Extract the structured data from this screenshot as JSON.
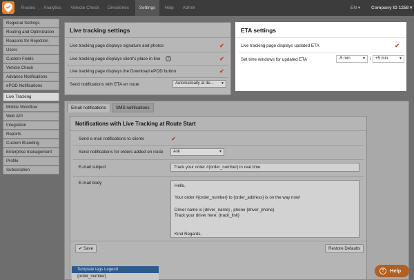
{
  "topnav": {
    "items": [
      "Routes",
      "Analytics",
      "Vehicle Check",
      "Directories",
      "Settings",
      "Help",
      "Admin"
    ],
    "active": "Settings",
    "language": "EN",
    "company": "Company ID 1258"
  },
  "sidebar": {
    "items": [
      "Regional Settings",
      "Routing and Optimization",
      "Reasons for Rejection",
      "Users",
      "Custom Fields",
      "Vehicle Check",
      "Advance Notifications",
      "ePOD Notifications",
      "Live Tracking",
      "Mobile Workflow",
      "Web API",
      "Integration",
      "Reports",
      "Custom Branding",
      "Enterprise management",
      "Profile",
      "Subscription"
    ],
    "active": "Live Tracking"
  },
  "live_tracking": {
    "title": "Live tracking settings",
    "rows": [
      "Live tracking page displays signature and photos",
      "Live tracking page displays client's place in line",
      "Live tracking page displays the Download ePOD button"
    ],
    "notify_label": "Send notifications with ETA en route",
    "notify_value": "Automatically at de..."
  },
  "eta": {
    "title": "ETA settings",
    "updated_label": "Live tracking page displays updated ETA",
    "window_label": "Set time windows for updated ETA",
    "min_value": "-5 min",
    "separator": "/",
    "max_value": "+5 min"
  },
  "tabs": [
    "Email notifications",
    "SMS notifications"
  ],
  "email": {
    "title": "Notifications with Live Tracking at Route Start",
    "send_clients_label": "Send e-mail notifications to clients",
    "send_orders_label": "Send notifications for orders added en route",
    "send_orders_value": "Ask",
    "subject_label": "E-mail subject",
    "subject_value": "Track your order #{order_number} in real time",
    "body_label": "E-mail body",
    "body_lines": [
      "Hello,",
      "",
      "Your order #{order_number} to {order_address} is on the way now!",
      "",
      "Driver name is {driver_name} , phone {driver_phone}",
      "Track your driver here: {track_link}",
      "",
      "",
      "Kind Regards,"
    ],
    "save_label": "Save",
    "restore_label": "Restore Defaults"
  },
  "legend": {
    "title": "Template tags Legend",
    "first_item": "{order_number}"
  },
  "help_label": "Help",
  "colors": {
    "accent": "#e4842c",
    "check": "#c0392b",
    "legend": "#2d5b8c"
  }
}
